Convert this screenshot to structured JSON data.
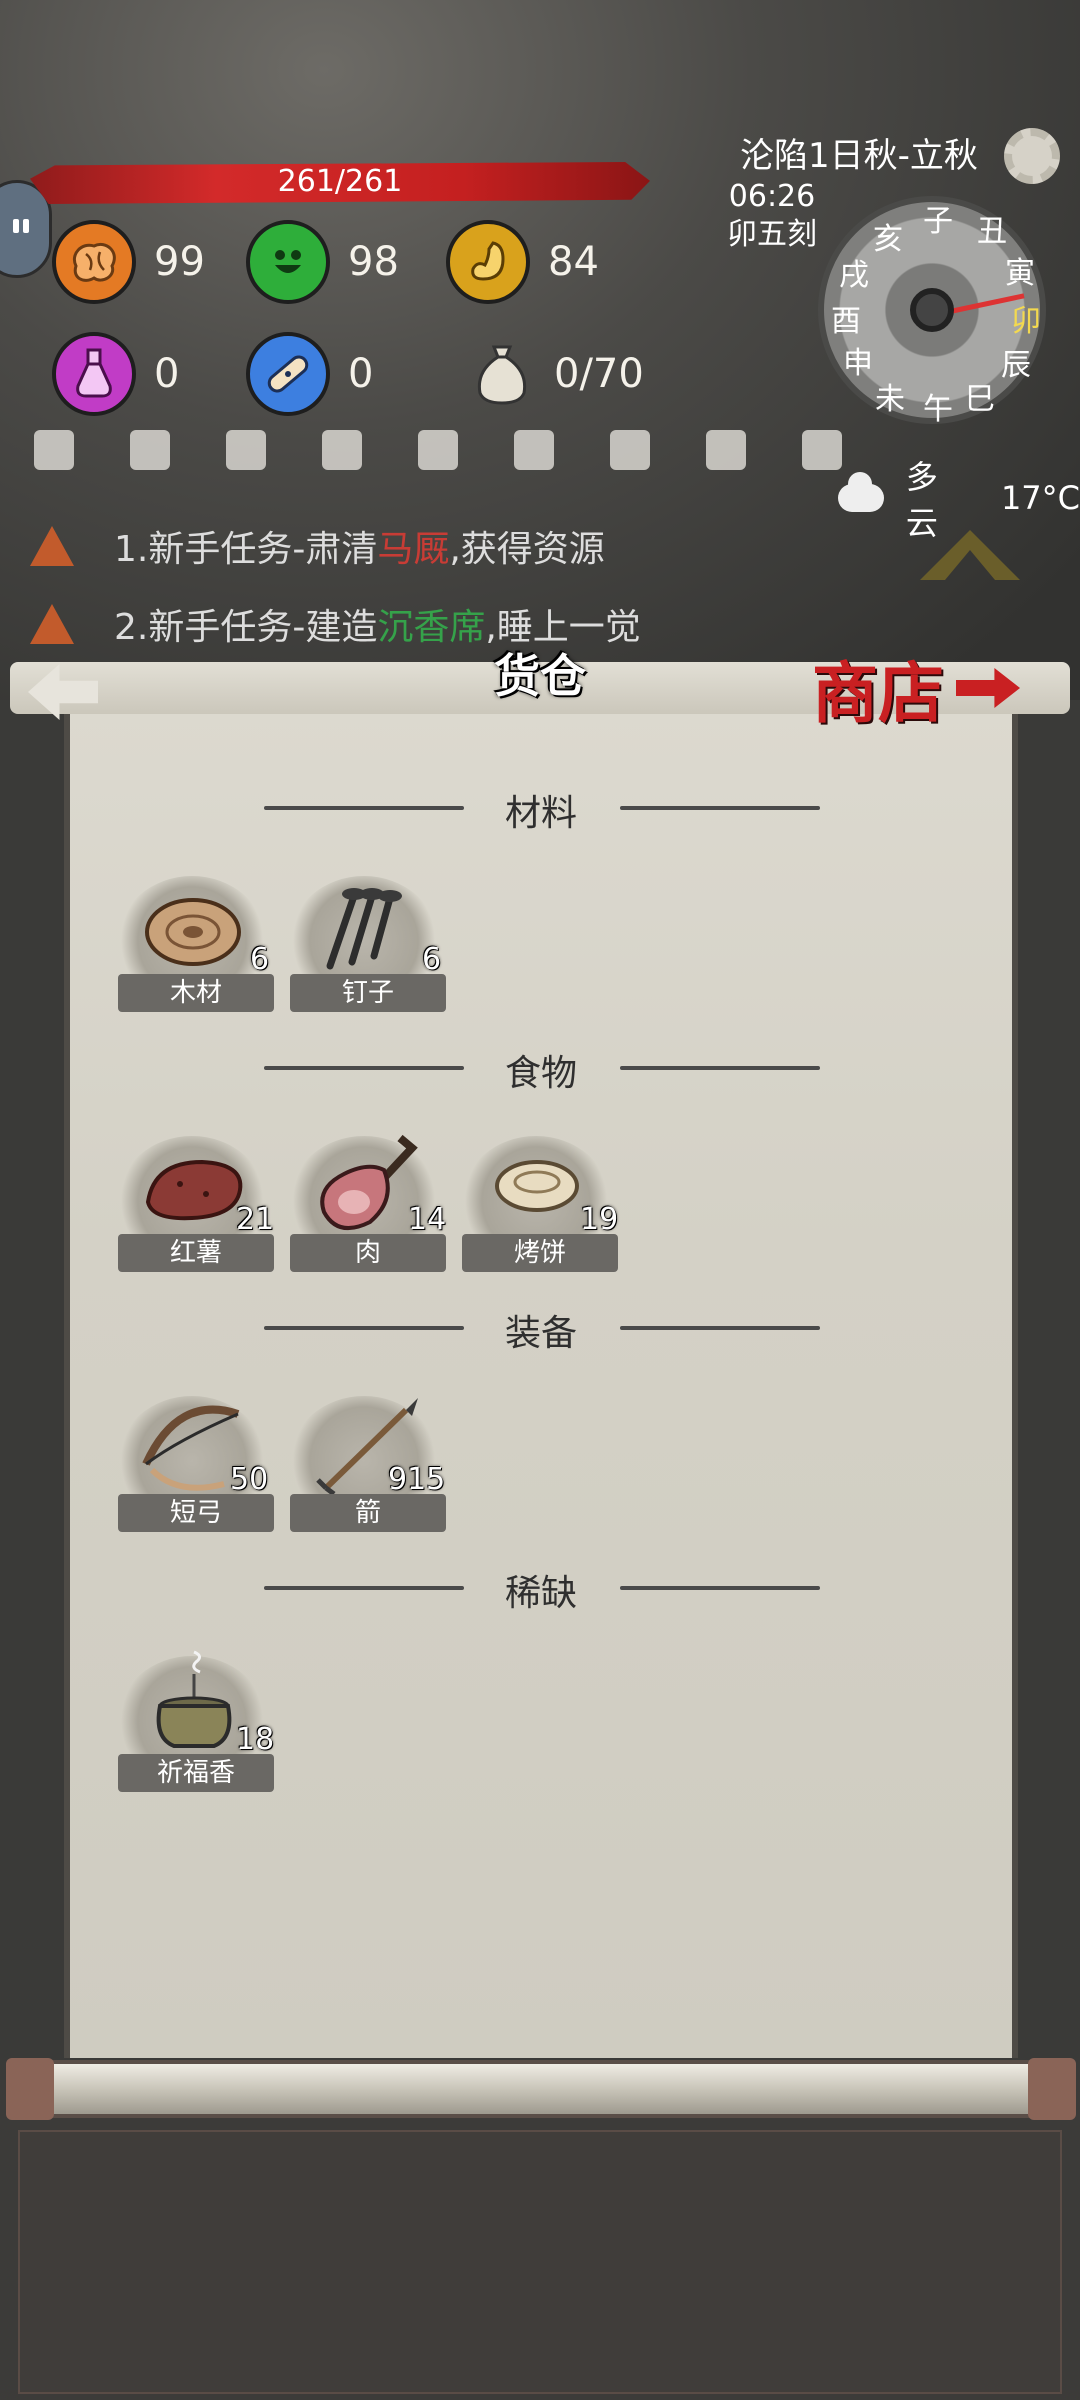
{
  "hud": {
    "hp_text": "261/261",
    "stats": [
      {
        "name": "brain",
        "value": "99",
        "color": "#e47a24",
        "icon": "brain-icon"
      },
      {
        "name": "mood",
        "value": "98",
        "color": "#2eae3a",
        "icon": "smile-icon"
      },
      {
        "name": "hunger",
        "value": "84",
        "color": "#d9a21c",
        "icon": "stomach-icon"
      },
      {
        "name": "poison",
        "value": "0",
        "color": "#c13cc6",
        "icon": "potion-icon"
      },
      {
        "name": "injury",
        "value": "0",
        "color": "#3d7fe0",
        "icon": "bandage-icon"
      },
      {
        "name": "bag",
        "value": "0/70",
        "icon": "money-bag-icon"
      }
    ]
  },
  "calendar": {
    "date": "沦陷1日秋-立秋",
    "time": "06:26",
    "period": "卯五刻",
    "hours": [
      "子",
      "丑",
      "寅",
      "卯",
      "辰",
      "巳",
      "午",
      "未",
      "申",
      "酉",
      "戌",
      "亥"
    ],
    "active_hour": "卯",
    "weather": "多云",
    "temperature": "17°C"
  },
  "quests": {
    "q1_prefix": "1.新手任务-肃清",
    "q1_highlight": "马厩",
    "q1_suffix": ",获得资源",
    "q2_prefix": "2.新手任务-建造",
    "q2_highlight": "沉香席",
    "q2_suffix": ",睡上一觉"
  },
  "warehouse": {
    "title": "货仓",
    "shop_label": "商店",
    "sections": [
      {
        "title": "材料",
        "items": [
          {
            "label": "木材",
            "count": "6"
          },
          {
            "label": "钉子",
            "count": "6"
          }
        ]
      },
      {
        "title": "食物",
        "items": [
          {
            "label": "红薯",
            "count": "21"
          },
          {
            "label": "肉",
            "count": "14"
          },
          {
            "label": "烤饼",
            "count": "19"
          }
        ]
      },
      {
        "title": "装备",
        "items": [
          {
            "label": "短弓",
            "count": "50"
          },
          {
            "label": "箭",
            "count": "915"
          }
        ]
      },
      {
        "title": "稀缺",
        "items": [
          {
            "label": "祈福香",
            "count": "18"
          }
        ]
      }
    ]
  }
}
